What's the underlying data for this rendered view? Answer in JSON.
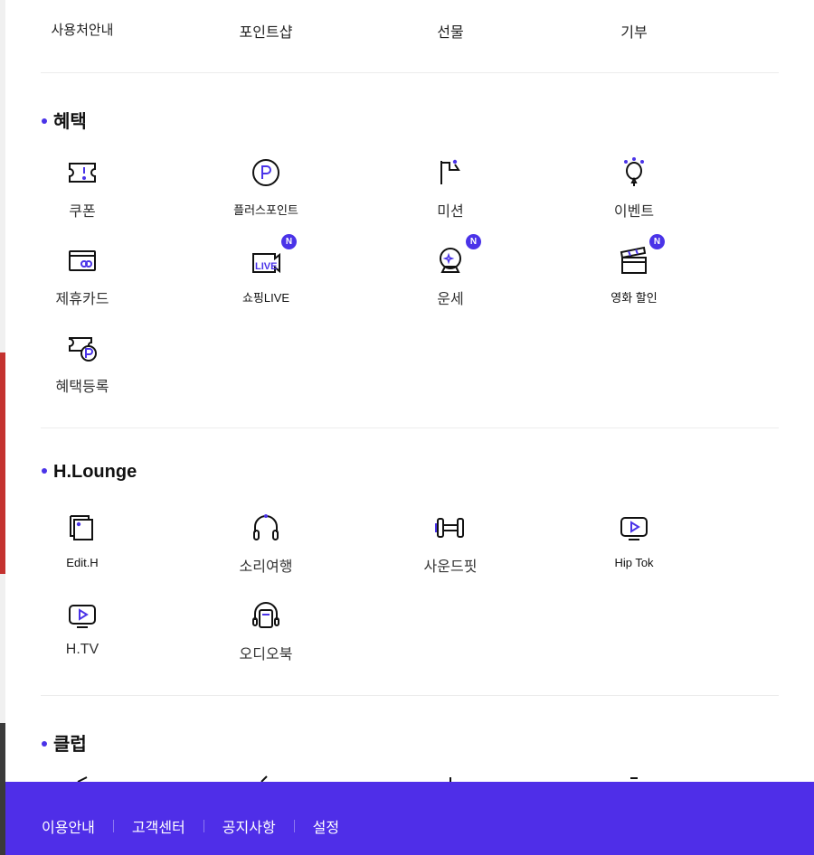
{
  "top_links": [
    "사용처안내",
    "포인트샵",
    "선물",
    "기부"
  ],
  "sections": {
    "benefits": {
      "title": "혜택",
      "items": [
        {
          "label": "쿠폰",
          "icon": "coupon-icon"
        },
        {
          "label": "플러스포인트",
          "icon": "plus-point-icon"
        },
        {
          "label": "미션",
          "icon": "flag-icon"
        },
        {
          "label": "이벤트",
          "icon": "balloon-icon"
        },
        {
          "label": "제휴카드",
          "icon": "card-icon"
        },
        {
          "label": "쇼핑LIVE",
          "icon": "live-camera-icon",
          "badge": "N"
        },
        {
          "label": "운세",
          "icon": "crystal-ball-icon",
          "badge": "N"
        },
        {
          "label": "영화 할인",
          "icon": "clapperboard-icon",
          "badge": "N"
        },
        {
          "label": "혜택등록",
          "icon": "ticket-point-icon"
        }
      ]
    },
    "lounge": {
      "title": "H.Lounge",
      "items": [
        {
          "label": "Edit.H",
          "icon": "magazine-icon"
        },
        {
          "label": "소리여행",
          "icon": "headphones-icon"
        },
        {
          "label": "사운드핏",
          "icon": "dumbbell-icon"
        },
        {
          "label": "Hip Tok",
          "icon": "video-play-icon"
        },
        {
          "label": "H.TV",
          "icon": "tv-play-icon"
        },
        {
          "label": "오디오북",
          "icon": "audiobook-icon"
        }
      ]
    },
    "club": {
      "title": "클럽"
    }
  },
  "footer": {
    "links": [
      "이용안내",
      "고객센터",
      "공지사항",
      "설정"
    ]
  },
  "colors": {
    "accent": "#4a33e8",
    "footer_bg": "#4f2ee8"
  }
}
